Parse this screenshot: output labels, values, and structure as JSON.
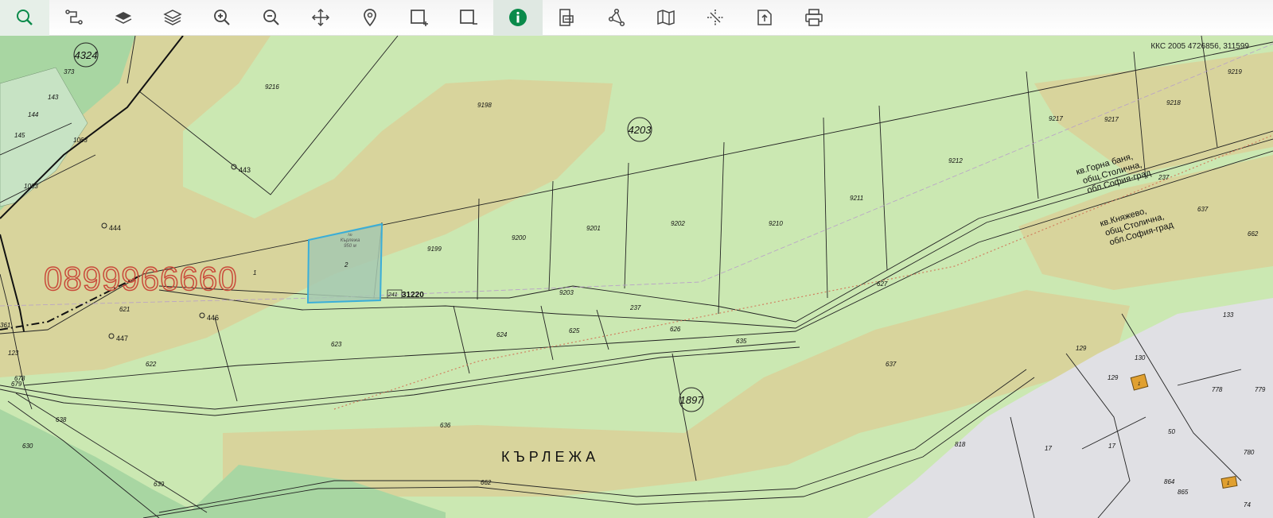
{
  "toolbar": {
    "tools": [
      {
        "id": "search",
        "icon": "search-icon"
      },
      {
        "id": "route",
        "icon": "route-icon"
      },
      {
        "id": "layer",
        "icon": "layer-icon"
      },
      {
        "id": "layers",
        "icon": "layers-icon"
      },
      {
        "id": "zoom-in",
        "icon": "zoom-in-icon"
      },
      {
        "id": "zoom-out",
        "icon": "zoom-out-icon"
      },
      {
        "id": "pan",
        "icon": "pan-move-icon"
      },
      {
        "id": "marker",
        "icon": "map-pin-icon"
      },
      {
        "id": "select-add",
        "icon": "rectangle-plus-icon"
      },
      {
        "id": "select-remove",
        "icon": "rectangle-minus-icon"
      },
      {
        "id": "info",
        "icon": "info-icon"
      },
      {
        "id": "measure",
        "icon": "measure-icon"
      },
      {
        "id": "share",
        "icon": "share-nodes-icon"
      },
      {
        "id": "map-view",
        "icon": "folded-map-icon"
      },
      {
        "id": "cut",
        "icon": "crosshair-cut-icon"
      },
      {
        "id": "export",
        "icon": "export-file-icon"
      },
      {
        "id": "print",
        "icon": "printer-icon"
      }
    ]
  },
  "map": {
    "coordinates": "ККС 2005 4726856, 311599",
    "watermark_phone": "0899966660",
    "place_name": "КЪРЛЕЖА",
    "selected_parcel": {
      "number": "2",
      "lines": [
        "№",
        "Кърлежа",
        "950 м"
      ]
    },
    "block_numbers": [
      "4324",
      "4203",
      "1897"
    ],
    "parcel_labels": [
      "373",
      "143",
      "144",
      "145",
      "1063",
      "1063",
      "9216",
      "9198",
      "9199",
      "9200",
      "9201",
      "9202",
      "9210",
      "9211",
      "9212",
      "9217",
      "9217",
      "9218",
      "9219",
      "1",
      "2",
      "9203",
      "237",
      "237",
      "621",
      "623",
      "622",
      "624",
      "625",
      "626",
      "635",
      "637",
      "637",
      "636",
      "638",
      "630",
      "639",
      "662",
      "662",
      "361",
      "123",
      "678",
      "679",
      "627",
      "133",
      "129",
      "130",
      "129",
      "778",
      "779",
      "50",
      "818",
      "17",
      "17",
      "780",
      "864",
      "865",
      "74"
    ],
    "point_labels": [
      "443",
      "444",
      "446",
      "447"
    ],
    "road_label": "31220",
    "road_small_label": "241",
    "region_labels": [
      [
        "кв.Горна баня,",
        "общ.Столична,",
        "обл.София-град"
      ],
      [
        "кв.Княжево,",
        "общ.Столична,",
        "обл.София-град"
      ]
    ],
    "marker_labels": [
      "1",
      "1"
    ],
    "colors": {
      "meadow": "#cbe8b2",
      "field": "#d8d49c",
      "forest": "#a8d6a2",
      "urban": "#e0e0e4",
      "selection": "#3aaed8",
      "accent": "#0a8a4a",
      "watermark": "#c94a3a"
    }
  }
}
